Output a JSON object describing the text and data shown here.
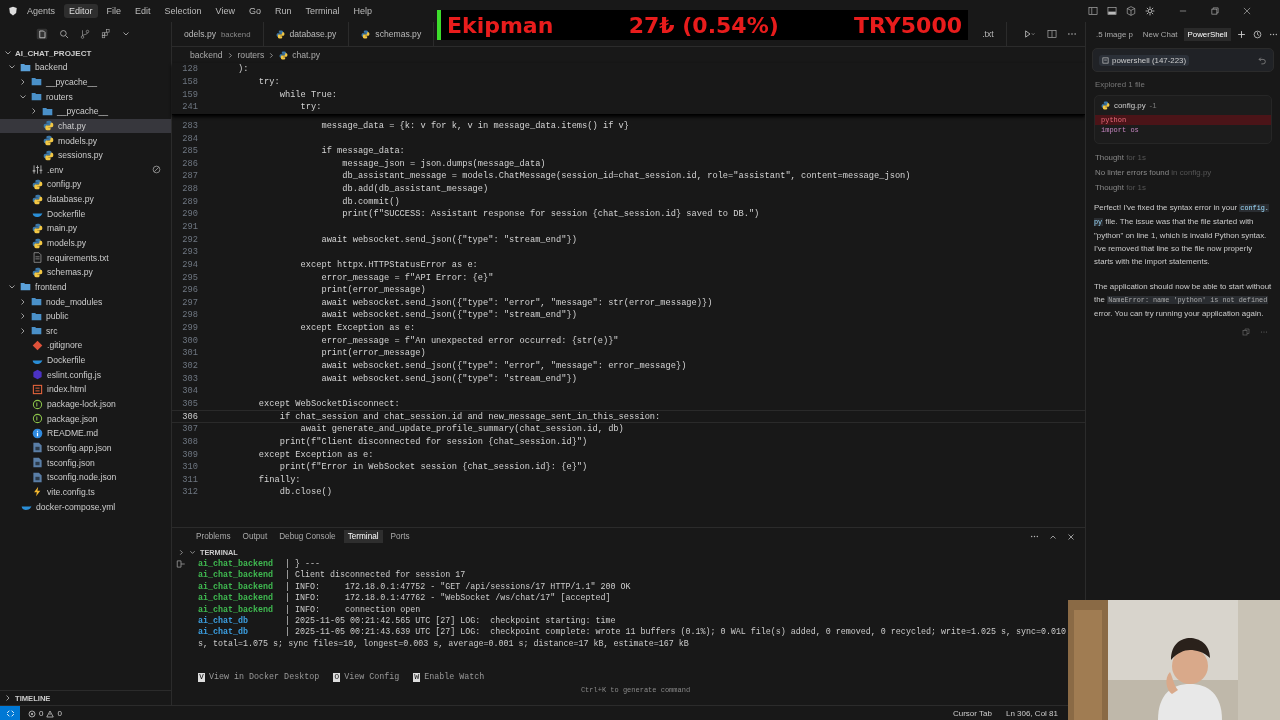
{
  "title_bar": {
    "menu": [
      {
        "label": "Agents",
        "selected": false
      },
      {
        "label": "Editor",
        "selected": true
      },
      {
        "label": "File",
        "selected": false
      },
      {
        "label": "Edit",
        "selected": false
      },
      {
        "label": "Selection",
        "selected": false
      },
      {
        "label": "View",
        "selected": false
      },
      {
        "label": "Go",
        "selected": false
      },
      {
        "label": "Run",
        "selected": false
      },
      {
        "label": "Terminal",
        "selected": false
      },
      {
        "label": "Help",
        "selected": false
      }
    ]
  },
  "ticker": {
    "label": "Ekipman",
    "change": "27₺ (0.54%)",
    "target": "TRY5000"
  },
  "explorer": {
    "project": "AI_CHAT_PROJECT",
    "tree": [
      {
        "name": "backend",
        "kind": "folder",
        "expanded": true,
        "selected": false,
        "children": [
          {
            "name": "__pycache__",
            "kind": "folder",
            "expanded": false,
            "selected": false
          },
          {
            "name": "routers",
            "kind": "folder",
            "expanded": true,
            "selected": false,
            "children": [
              {
                "name": "__pycache__",
                "kind": "folder",
                "expanded": false,
                "selected": false
              },
              {
                "name": "chat.py",
                "kind": "python",
                "selected": true
              },
              {
                "name": "models.py",
                "kind": "python",
                "selected": false
              },
              {
                "name": "sessions.py",
                "kind": "python",
                "selected": false
              }
            ]
          },
          {
            "name": ".env",
            "kind": "settings",
            "selected": false,
            "ignored": true
          },
          {
            "name": "config.py",
            "kind": "python",
            "selected": false
          },
          {
            "name": "database.py",
            "kind": "python",
            "selected": false
          },
          {
            "name": "Dockerfile",
            "kind": "docker",
            "selected": false
          },
          {
            "name": "main.py",
            "kind": "python",
            "selected": false
          },
          {
            "name": "models.py",
            "kind": "python",
            "selected": false
          },
          {
            "name": "requirements.txt",
            "kind": "text",
            "selected": false
          },
          {
            "name": "schemas.py",
            "kind": "python",
            "selected": false
          }
        ]
      },
      {
        "name": "frontend",
        "kind": "folder",
        "expanded": true,
        "selected": false,
        "children": [
          {
            "name": "node_modules",
            "kind": "folder",
            "expanded": false,
            "selected": false
          },
          {
            "name": "public",
            "kind": "folder",
            "expanded": false,
            "selected": false
          },
          {
            "name": "src",
            "kind": "folder",
            "expanded": false,
            "selected": false
          },
          {
            "name": ".gitignore",
            "kind": "git",
            "selected": false
          },
          {
            "name": "Dockerfile",
            "kind": "docker",
            "selected": false
          },
          {
            "name": "eslint.config.js",
            "kind": "eslint",
            "selected": false
          },
          {
            "name": "index.html",
            "kind": "html",
            "selected": false
          },
          {
            "name": "package-lock.json",
            "kind": "json",
            "selected": false
          },
          {
            "name": "package.json",
            "kind": "json",
            "selected": false
          },
          {
            "name": "README.md",
            "kind": "info",
            "selected": false
          },
          {
            "name": "tsconfig.app.json",
            "kind": "ts",
            "selected": false
          },
          {
            "name": "tsconfig.json",
            "kind": "ts",
            "selected": false
          },
          {
            "name": "tsconfig.node.json",
            "kind": "ts",
            "selected": false
          },
          {
            "name": "vite.config.ts",
            "kind": "bolt",
            "selected": false
          }
        ]
      },
      {
        "name": "docker-compose.yml",
        "kind": "docker",
        "selected": false
      }
    ],
    "timeline": "TIMELINE"
  },
  "editor": {
    "tabs": [
      {
        "label": "odels.py",
        "detail": "backend",
        "selected": false
      },
      {
        "label": "database.py",
        "selected": false
      },
      {
        "label": "schemas.py",
        "selected": false
      },
      {
        "label": ".txt",
        "selected": false
      }
    ],
    "breadcrumb": [
      "backend",
      "routers",
      "chat.py"
    ],
    "sticky_lines": [
      {
        "number": "128",
        "text": "):"
      },
      {
        "number": "158",
        "text": "    try:"
      },
      {
        "number": "159",
        "text": "        while True:"
      },
      {
        "number": "241",
        "text": "            try:"
      }
    ],
    "lines": [
      {
        "number": "283",
        "text": "                message_data = {k: v for k, v in message_data.items() if v}",
        "current": false
      },
      {
        "number": "284",
        "current": false
      },
      {
        "number": "285",
        "text": "                if message_data:",
        "current": false
      },
      {
        "number": "286",
        "text": "                    message_json = json.dumps(message_data)",
        "current": false
      },
      {
        "number": "287",
        "text": "                    db_assistant_message = models.ChatMessage(session_id=chat_session.id, role=\"assistant\", content=message_json)",
        "current": false
      },
      {
        "number": "288",
        "text": "                    db.add(db_assistant_message)",
        "current": false
      },
      {
        "number": "289",
        "text": "                    db.commit()",
        "current": false
      },
      {
        "number": "290",
        "text": "                    print(f\"SUCCESS: Assistant response for session {chat_session.id} saved to DB.\")",
        "current": false
      },
      {
        "number": "291",
        "current": false
      },
      {
        "number": "292",
        "text": "                await websocket.send_json({\"type\": \"stream_end\"})",
        "current": false
      },
      {
        "number": "293",
        "current": false
      },
      {
        "number": "294",
        "text": "            except httpx.HTTPStatusError as e:",
        "current": false
      },
      {
        "number": "295",
        "text": "                error_message = f\"API Error: {e}\"",
        "current": false
      },
      {
        "number": "296",
        "text": "                print(error_message)",
        "current": false
      },
      {
        "number": "297",
        "text": "                await websocket.send_json({\"type\": \"error\", \"message\": str(error_message)})",
        "current": false
      },
      {
        "number": "298",
        "text": "                await websocket.send_json({\"type\": \"stream_end\"})",
        "current": false
      },
      {
        "number": "299",
        "text": "            except Exception as e:",
        "current": false
      },
      {
        "number": "300",
        "text": "                error_message = f\"An unexpected error occurred: {str(e)}\"",
        "current": false
      },
      {
        "number": "301",
        "text": "                print(error_message)",
        "current": false
      },
      {
        "number": "302",
        "text": "                await websocket.send_json({\"type\": \"error\", \"message\": error_message})",
        "current": false
      },
      {
        "number": "303",
        "text": "                await websocket.send_json({\"type\": \"stream_end\"})",
        "current": false
      },
      {
        "number": "304",
        "current": false
      },
      {
        "number": "305",
        "text": "    except WebSocketDisconnect:",
        "current": false
      },
      {
        "number": "306",
        "text": "        if chat_session and chat_session.id and new_message_sent_in_this_session:",
        "current": true
      },
      {
        "number": "307",
        "text": "            await generate_and_update_profile_summary(chat_session.id, db)",
        "current": false
      },
      {
        "number": "308",
        "text": "        print(f\"Client disconnected for session {chat_session.id}\")",
        "current": false
      },
      {
        "number": "309",
        "text": "    except Exception as e:",
        "current": false
      },
      {
        "number": "310",
        "text": "        print(f\"Error in WebSocket session {chat_session.id}: {e}\")",
        "current": false
      },
      {
        "number": "311",
        "text": "    finally:",
        "current": false
      },
      {
        "number": "312",
        "text": "        db.close()",
        "current": false
      }
    ]
  },
  "panel": {
    "tabs": [
      {
        "label": "Problems",
        "selected": false
      },
      {
        "label": "Output",
        "selected": false
      },
      {
        "label": "Debug Console",
        "selected": false
      },
      {
        "label": "Terminal",
        "selected": true
      },
      {
        "label": "Ports",
        "selected": false
      }
    ],
    "section": "TERMINAL",
    "lines": [
      {
        "service": "ai_chat_backend",
        "color": "#3fb950",
        "message": "| } ---"
      },
      {
        "service": "ai_chat_backend",
        "color": "#3fb950",
        "message": "| Client disconnected for session 17"
      },
      {
        "service": "ai_chat_backend",
        "color": "#3fb950",
        "message": "| INFO:     172.18.0.1:47752 - \"GET /api/sessions/17 HTTP/1.1\" 200 OK"
      },
      {
        "service": "ai_chat_backend",
        "color": "#3fb950",
        "message": "| INFO:     172.18.0.1:47762 - \"WebSocket /ws/chat/17\" [accepted]"
      },
      {
        "service": "ai_chat_backend",
        "color": "#3fb950",
        "message": "| INFO:     connection open"
      },
      {
        "service": "ai_chat_db",
        "color": "#3b9ee0",
        "message": "| 2025-11-05 00:21:42.565 UTC [27] LOG:  checkpoint starting: time"
      },
      {
        "service": "ai_chat_db",
        "color": "#3b9ee0",
        "message": "| 2025-11-05 00:21:43.639 UTC [27] LOG:  checkpoint complete: wrote 11 buffers (0.1%); 0 WAL file(s) added, 0 removed, 0 recycled; write=1.025 s, sync=0.010 s, total=1.075 s; sync files=10, longest=0.003 s, average=0.001 s; distance=17 kB, estimate=167 kB"
      }
    ],
    "actions": [
      {
        "key": "v",
        "label": "View in Docker Desktop"
      },
      {
        "key": "o",
        "label": "View Config"
      },
      {
        "key": "w",
        "label": "Enable Watch"
      }
    ],
    "hint": "Ctrl+K to generate command"
  },
  "chat": {
    "tabs": [
      {
        "label": ".5 image p",
        "selected": false
      },
      {
        "label": "New Chat",
        "selected": false
      },
      {
        "label": "PowerShell",
        "selected": true
      }
    ],
    "context": "powershell (147-223)",
    "explored": "Explored 1 file",
    "file_card": {
      "name": "config.py",
      "suffix": "-1",
      "lines": [
        {
          "text": "python",
          "kind": "removed"
        },
        {
          "text": "import os",
          "kind": "normal"
        }
      ]
    },
    "steps": [
      {
        "main": "Thought",
        "detail": "for 1s"
      },
      {
        "main": "No linter errors found",
        "detail": "in config.py"
      },
      {
        "main": "Thought",
        "detail": "for 1s"
      }
    ],
    "paragraphs": [
      [
        {
          "kind": "text",
          "text": "Perfect! I've fixed the syntax error in your "
        },
        {
          "kind": "code",
          "text": "config.py"
        },
        {
          "kind": "text",
          "text": " file. The issue was that the file started with \"python\" on line 1, which is invalid Python syntax. I've removed that line so the file now properly starts with the import statements."
        }
      ],
      [
        {
          "kind": "text",
          "text": "The application should now be able to start without the "
        },
        {
          "kind": "code",
          "text": "NameError: name 'python' is not defined"
        },
        {
          "kind": "text",
          "text": " error. You can try running your application again."
        }
      ]
    ]
  },
  "status_bar": {
    "errors": "0",
    "warnings": "0",
    "cursor_tab": "Cursor Tab",
    "position": "Ln 306, Col 81"
  }
}
